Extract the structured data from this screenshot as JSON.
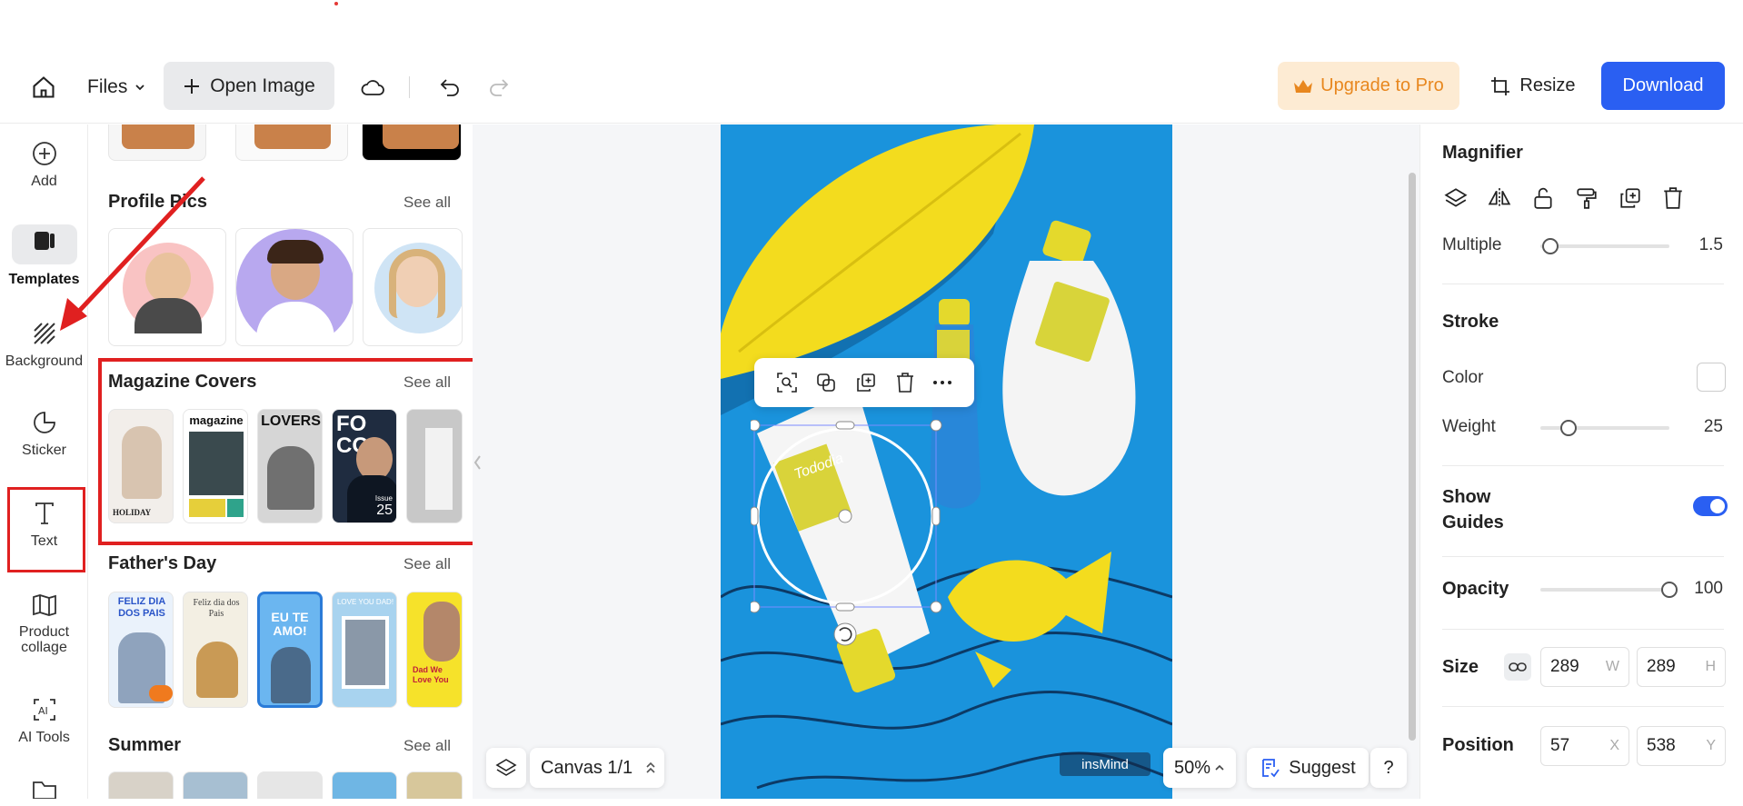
{
  "toolbar": {
    "files_label": "Files",
    "open_image_label": "Open Image",
    "upgrade_label": "Upgrade to Pro",
    "resize_label": "Resize",
    "download_label": "Download"
  },
  "leftnav": {
    "items": [
      {
        "label": "Add",
        "icon": "plus-circle-icon"
      },
      {
        "label": "Templates",
        "icon": "templates-icon"
      },
      {
        "label": "Background",
        "icon": "hatch-icon"
      },
      {
        "label": "Sticker",
        "icon": "sticker-icon"
      },
      {
        "label": "Text",
        "icon": "text-icon"
      },
      {
        "label": "Product collage",
        "icon": "collage-icon"
      },
      {
        "label": "AI Tools",
        "icon": "ai-icon"
      }
    ]
  },
  "panel": {
    "sections": [
      {
        "title": "Profile Pics",
        "see_all": "See all"
      },
      {
        "title": "Magazine Covers",
        "see_all": "See all"
      },
      {
        "title": "Father's Day",
        "see_all": "See all"
      },
      {
        "title": "Summer",
        "see_all": "See all"
      }
    ],
    "magazine_thumbs": {
      "holiday": "HOLIDAY",
      "magazine": "magazine",
      "lovers": "LOVERS",
      "foco_top": "FO",
      "foco_bottom": "CO",
      "issue": "Issue",
      "issue_num": "25"
    },
    "fathers_thumbs": {
      "feliz1": "FELIZ DIA DOS PAIS",
      "feliz2": "Feliz dia dos Pais",
      "eute": "EU TE AMO!",
      "loveyou": "LOVE YOU DAD!",
      "dad": "Dad We Love You"
    }
  },
  "canvas": {
    "label": "Canvas 1/1",
    "zoom": "50%",
    "suggest_label": "Suggest",
    "help_label": "?",
    "watermark": "insMind",
    "product_label": "Tododia"
  },
  "rightpanel": {
    "title": "Magnifier",
    "multiple_label": "Multiple",
    "multiple_value": "1.5",
    "multiple_fraction": 0.08,
    "stroke_title": "Stroke",
    "color_label": "Color",
    "weight_label": "Weight",
    "weight_value": "25",
    "weight_fraction": 0.22,
    "show_guides_line1": "Show",
    "show_guides_line2": "Guides",
    "opacity_label": "Opacity",
    "opacity_value": "100",
    "opacity_fraction": 1.0,
    "size_label": "Size",
    "size_w": "289",
    "size_w_unit": "W",
    "size_h": "289",
    "size_h_unit": "H",
    "position_label": "Position",
    "pos_x": "57",
    "pos_x_unit": "X",
    "pos_y": "538",
    "pos_y_unit": "Y"
  },
  "colors": {
    "accent": "#2a5ff2",
    "upgrade_bg": "#fdebd3",
    "upgrade_text": "#e8871e",
    "highlight_red": "#e02020",
    "artboard_blue": "#1a93dc",
    "leaf_yellow": "#f3dc1e"
  }
}
